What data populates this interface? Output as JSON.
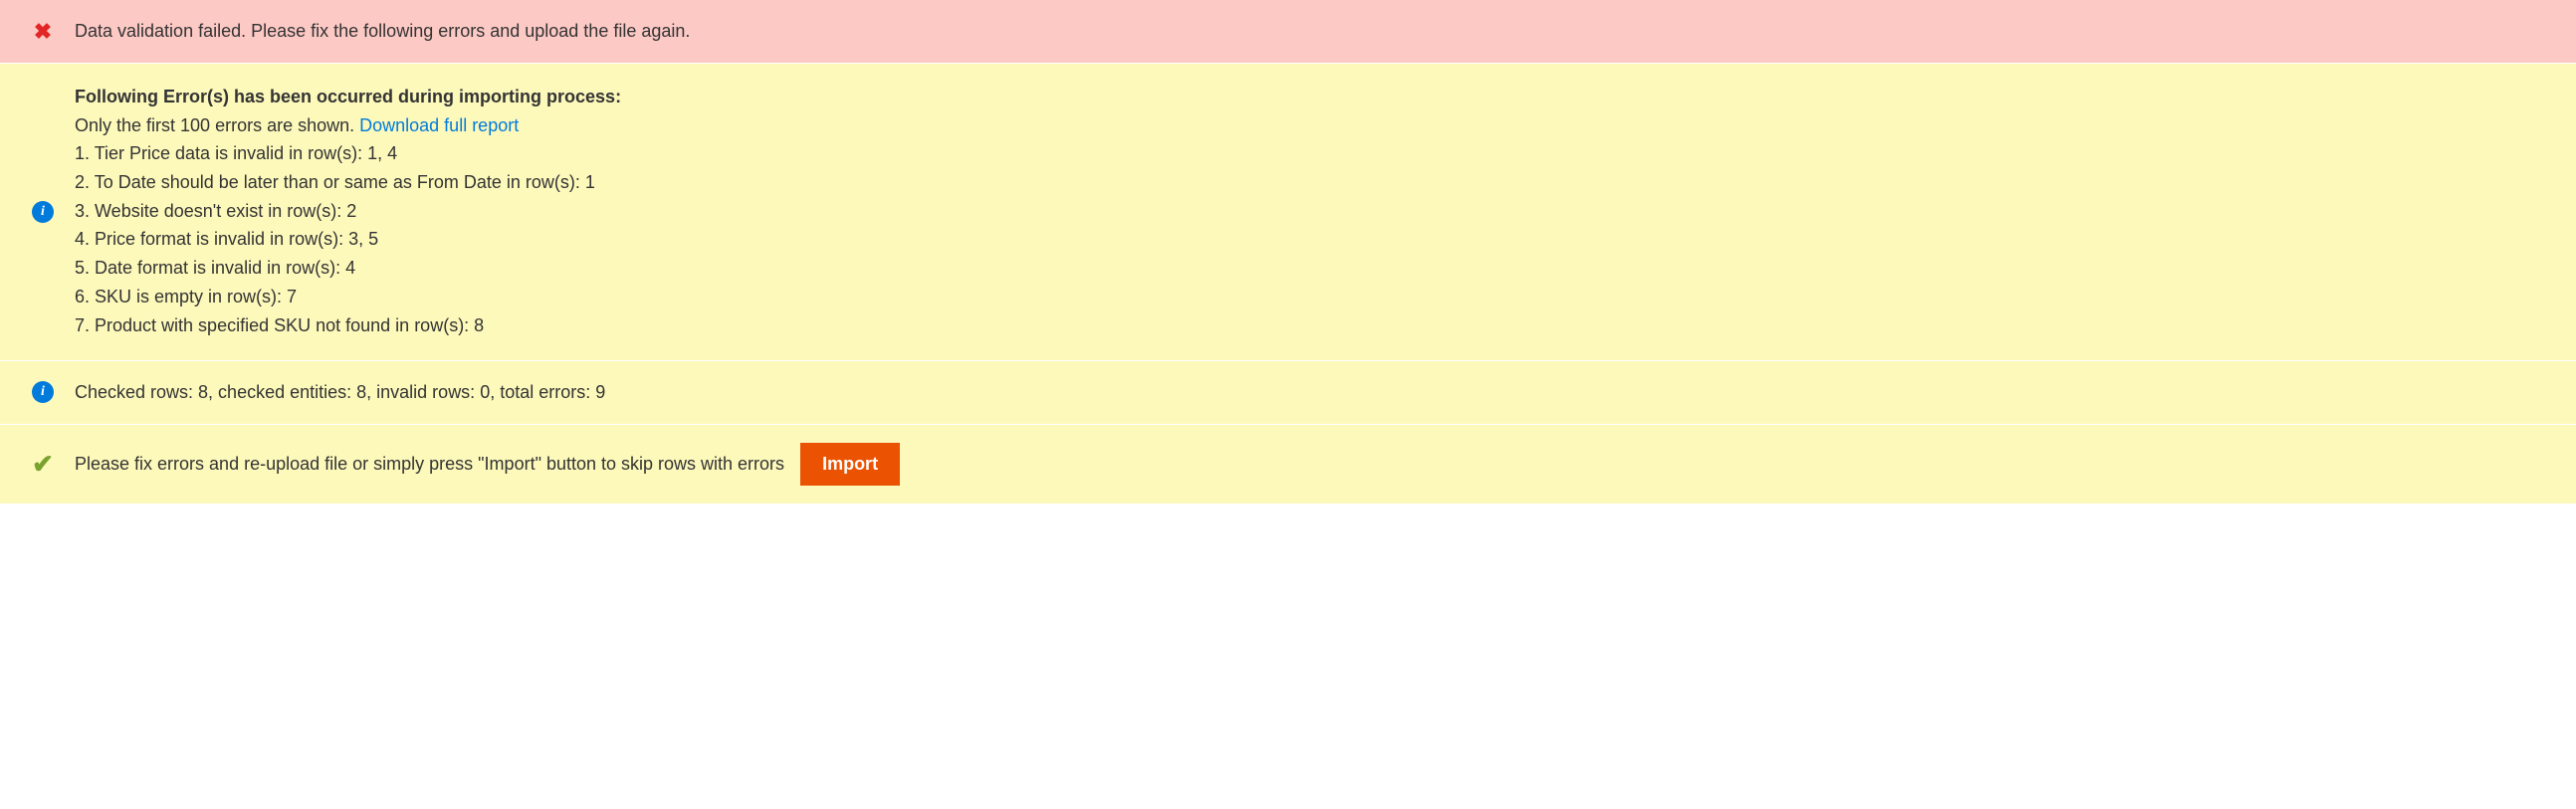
{
  "error": {
    "message": "Data validation failed. Please fix the following errors and upload the file again."
  },
  "errorDetails": {
    "title": "Following Error(s) has been occurred during importing process:",
    "prefix": "Only the first 100 errors are shown. ",
    "downloadLabel": "Download full report",
    "items": [
      "1. Tier Price data is invalid in row(s): 1, 4",
      "2. To Date should be later than or same as From Date in row(s): 1",
      "3. Website doesn't exist in row(s): 2",
      "4. Price format is invalid in row(s): 3, 5",
      "5. Date format is invalid in row(s): 4",
      "6. SKU is empty in row(s): 7",
      "7. Product with specified SKU not found in row(s): 8"
    ]
  },
  "summary": {
    "text": "Checked rows: 8, checked entities: 8, invalid rows: 0, total errors: 9"
  },
  "action": {
    "message": "Please fix errors and re-upload file or simply press \"Import\" button to skip rows with errors",
    "buttonLabel": "Import"
  }
}
